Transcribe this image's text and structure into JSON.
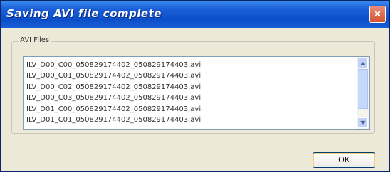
{
  "window": {
    "title": "Saving AVI file complete",
    "close_symbol": "✕"
  },
  "group": {
    "label": "AVI Files"
  },
  "files": [
    "ILV_D00_C00_050829174402_050829174403.avi",
    "ILV_D00_C01_050829174402_050829174403.avi",
    "ILV_D00_C02_050829174402_050829174403.avi",
    "ILV_D00_C03_050829174402_050829174403.avi",
    "ILV_D01_C00_050829174402_050829174403.avi",
    "ILV_D01_C01_050829174402_050829174403.avi"
  ],
  "scrollbar": {
    "up_symbol": "▲",
    "down_symbol": "▼"
  },
  "buttons": {
    "ok_label": "OK"
  },
  "colors": {
    "titlebar": "#0a4ec9",
    "dialog_bg": "#ece9d8",
    "close_button": "#d2512f"
  }
}
